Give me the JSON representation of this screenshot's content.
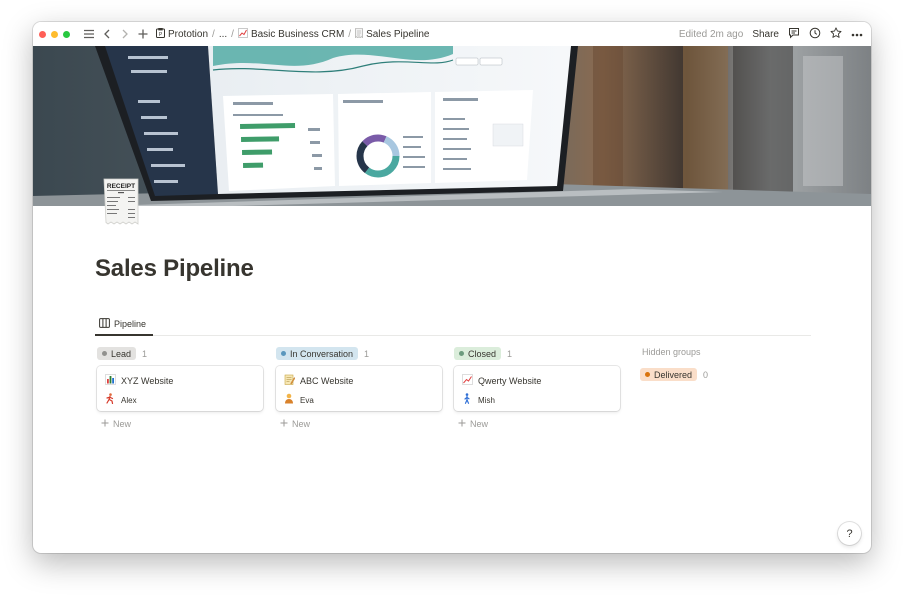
{
  "breadcrumb": {
    "workspace": "Prototion",
    "ellipsis": "...",
    "parent": "Basic Business CRM",
    "parent_icon": "chart-increasing-emoji",
    "current": "Sales Pipeline",
    "current_icon": "receipt-emoji"
  },
  "topbar": {
    "edited": "Edited 2m ago",
    "share": "Share"
  },
  "page": {
    "title": "Sales Pipeline"
  },
  "cover_screen": {
    "items": [
      "Data Presentation",
      "Additional Pages",
      "Widgets",
      "UI Elements",
      "Data Presentation",
      "UI Elements",
      "Data Presentation",
      "Using Sass"
    ],
    "legend_top": [
      "Line One",
      "Line Eight"
    ],
    "panel1_title": "Daily active users",
    "panel1_sub": "App Usage across website",
    "panel2_title": "Daily active users",
    "panel3_title": "Daily active users",
    "values": [
      "123k",
      "53k",
      "23k",
      "3k"
    ],
    "tabs": [
      "Top 5",
      "Document",
      "Progress"
    ],
    "donut_legend": [
      "Marketing",
      "Media",
      "Engagement",
      "Awareness"
    ],
    "panel3_rows": [
      "Settings",
      "Subscription",
      "Auto Renewal",
      "Achievements",
      "Auto Renewal",
      "Achievements"
    ],
    "account": "Account Balance"
  },
  "view": {
    "tab_label": "Pipeline"
  },
  "board": {
    "columns": [
      {
        "label": "Lead",
        "count": "1",
        "color": "#e3e2e0",
        "dot": "#91918e",
        "card": {
          "title": "XYZ Website",
          "icon": "bar-chart-emoji",
          "person": "Alex",
          "person_icon": "person-running-emoji"
        }
      },
      {
        "label": "In Conversation",
        "count": "1",
        "color": "#d3e5ef",
        "dot": "#5b97bd",
        "card": {
          "title": "ABC Website",
          "icon": "memo-emoji",
          "person": "Eva",
          "person_icon": "person-emoji"
        }
      },
      {
        "label": "Closed",
        "count": "1",
        "color": "#dbeddb",
        "dot": "#6c9b7d",
        "card": {
          "title": "Qwerty Website",
          "icon": "chart-increasing-emoji",
          "person": "Mish",
          "person_icon": "person-walking-emoji"
        }
      }
    ],
    "new_label": "New",
    "hidden_groups_label": "Hidden groups",
    "hidden": {
      "label": "Delivered",
      "count": "0",
      "color": "#fadec9",
      "dot": "#d9730d"
    }
  },
  "help": {
    "label": "?"
  },
  "receipt_icon_text": {
    "title": "RECEIPT"
  }
}
